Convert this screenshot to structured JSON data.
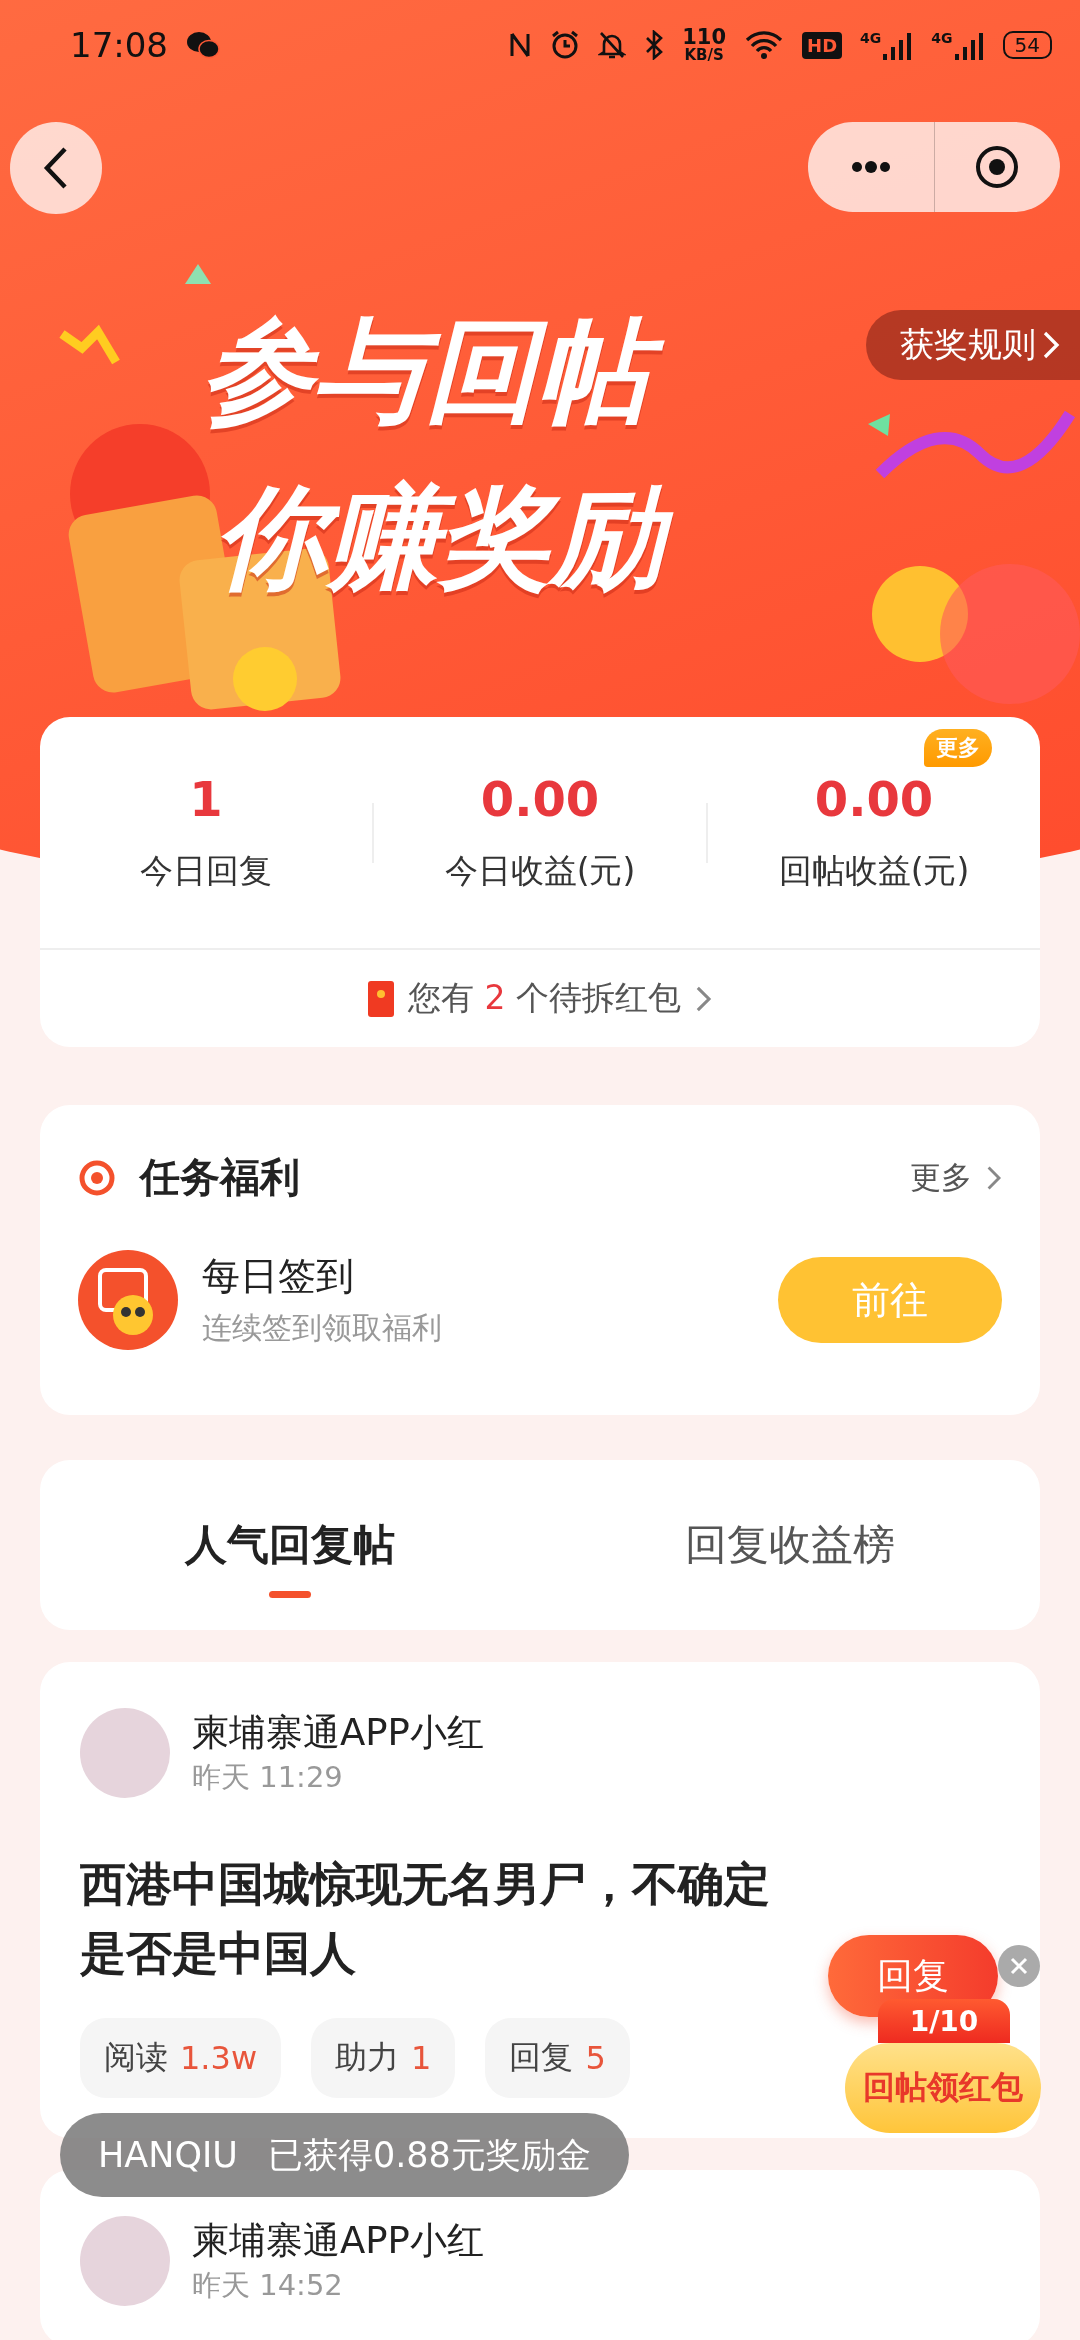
{
  "status_bar": {
    "time": "17:08",
    "speed_value": "110",
    "speed_unit": "KB/S",
    "hd_label": "HD",
    "network_labels": [
      "4G",
      "4G"
    ],
    "battery": "54"
  },
  "banner": {
    "rules_button": "获奖规则",
    "title_lines": [
      "参与回帖",
      "你赚奖励"
    ]
  },
  "stats": {
    "items": [
      {
        "value": "1",
        "label": "今日回复"
      },
      {
        "value": "0.00",
        "label": "今日收益(元)"
      },
      {
        "value": "0.00",
        "label": "回帖收益(元)",
        "badge": "更多"
      }
    ],
    "notice": {
      "prefix": "您有",
      "count": "2",
      "suffix": "个待拆红包"
    }
  },
  "tasks": {
    "title": "任务福利",
    "more": "更多",
    "items": [
      {
        "name": "每日签到",
        "description": "连续签到领取福利",
        "action": "前往"
      }
    ]
  },
  "tabs": [
    {
      "label": "人气回复帖",
      "selected": true
    },
    {
      "label": "回复收益榜",
      "selected": false
    }
  ],
  "posts": [
    {
      "author": "柬埔寨通APP小红",
      "time": "昨天 11:29",
      "title": "西港中国城惊现无名男尸，不确定是否是中国人",
      "stats": [
        {
          "label": "阅读",
          "value": "1.3w"
        },
        {
          "label": "助力",
          "value": "1"
        },
        {
          "label": "回复",
          "value": "5"
        }
      ]
    },
    {
      "author": "柬埔寨通APP小红",
      "time": "昨天 14:52"
    }
  ],
  "floating": {
    "reply_button": "回复",
    "progress": "1/10",
    "reward_label": "回帖领红包"
  },
  "toast": {
    "user": "HANQIU",
    "message": "已获得0.88元奖励金"
  }
}
